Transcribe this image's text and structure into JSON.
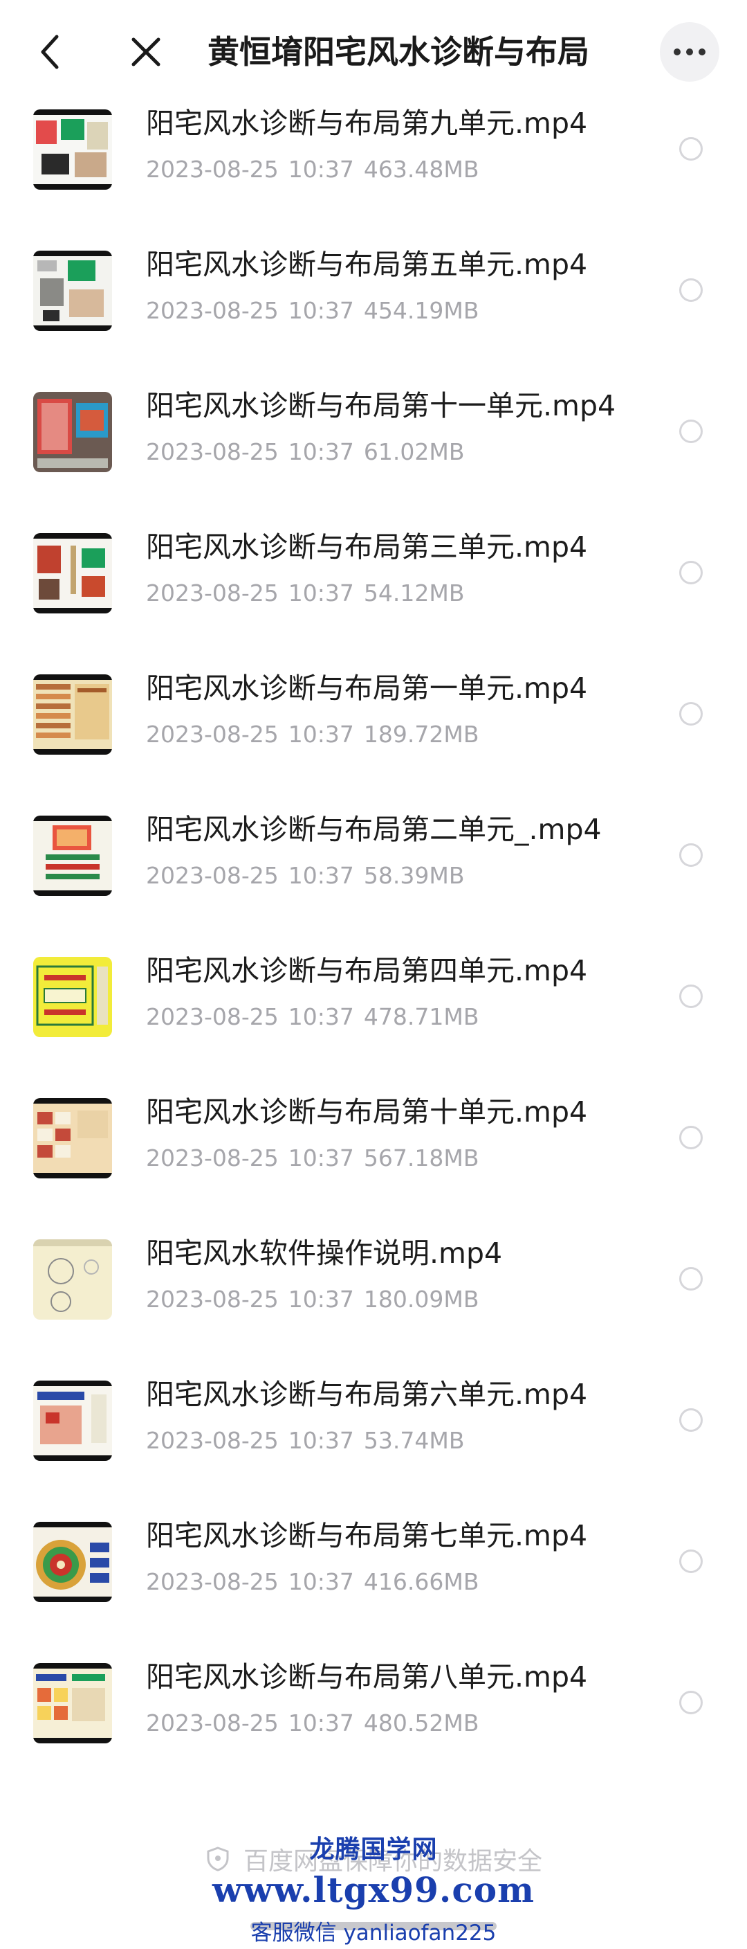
{
  "header": {
    "title": "黄恒堉阳宅风水诊断与布局",
    "back_icon": "chevron-left-icon",
    "close_icon": "close-icon",
    "more_icon": "more-horizontal-icon"
  },
  "files": [
    {
      "name": "阳宅风水诊断与布局第九单元.mp4",
      "date": "2023-08-25",
      "time": "10:37",
      "size": "463.48MB",
      "thumb": "video-thumbnail"
    },
    {
      "name": "阳宅风水诊断与布局第五单元.mp4",
      "date": "2023-08-25",
      "time": "10:37",
      "size": "454.19MB",
      "thumb": "video-thumbnail"
    },
    {
      "name": "阳宅风水诊断与布局第十一单元.mp4",
      "date": "2023-08-25",
      "time": "10:37",
      "size": "61.02MB",
      "thumb": "video-thumbnail"
    },
    {
      "name": "阳宅风水诊断与布局第三单元.mp4",
      "date": "2023-08-25",
      "time": "10:37",
      "size": "54.12MB",
      "thumb": "video-thumbnail"
    },
    {
      "name": "阳宅风水诊断与布局第一单元.mp4",
      "date": "2023-08-25",
      "time": "10:37",
      "size": "189.72MB",
      "thumb": "video-thumbnail"
    },
    {
      "name": "阳宅风水诊断与布局第二单元_.mp4",
      "date": "2023-08-25",
      "time": "10:37",
      "size": "58.39MB",
      "thumb": "video-thumbnail"
    },
    {
      "name": "阳宅风水诊断与布局第四单元.mp4",
      "date": "2023-08-25",
      "time": "10:37",
      "size": "478.71MB",
      "thumb": "video-thumbnail"
    },
    {
      "name": "阳宅风水诊断与布局第十单元.mp4",
      "date": "2023-08-25",
      "time": "10:37",
      "size": "567.18MB",
      "thumb": "video-thumbnail"
    },
    {
      "name": "阳宅风水软件操作说明.mp4",
      "date": "2023-08-25",
      "time": "10:37",
      "size": "180.09MB",
      "thumb": "video-thumbnail"
    },
    {
      "name": "阳宅风水诊断与布局第六单元.mp4",
      "date": "2023-08-25",
      "time": "10:37",
      "size": "53.74MB",
      "thumb": "video-thumbnail"
    },
    {
      "name": "阳宅风水诊断与布局第七单元.mp4",
      "date": "2023-08-25",
      "time": "10:37",
      "size": "416.66MB",
      "thumb": "video-thumbnail"
    },
    {
      "name": "阳宅风水诊断与布局第八单元.mp4",
      "date": "2023-08-25",
      "time": "10:37",
      "size": "480.52MB",
      "thumb": "video-thumbnail"
    }
  ],
  "footer": {
    "secure_text": "百度网盘保障你的数据安全",
    "secure_icon": "shield-icon"
  },
  "watermark": {
    "name": "龙腾国学网",
    "url": "www.ltgx99.com",
    "contact": "客服微信 yanliaofan225"
  },
  "colors": {
    "accent_watermark": "#1a3fae",
    "meta_text": "#a6a6ab",
    "radio_border": "#d6d6da"
  }
}
